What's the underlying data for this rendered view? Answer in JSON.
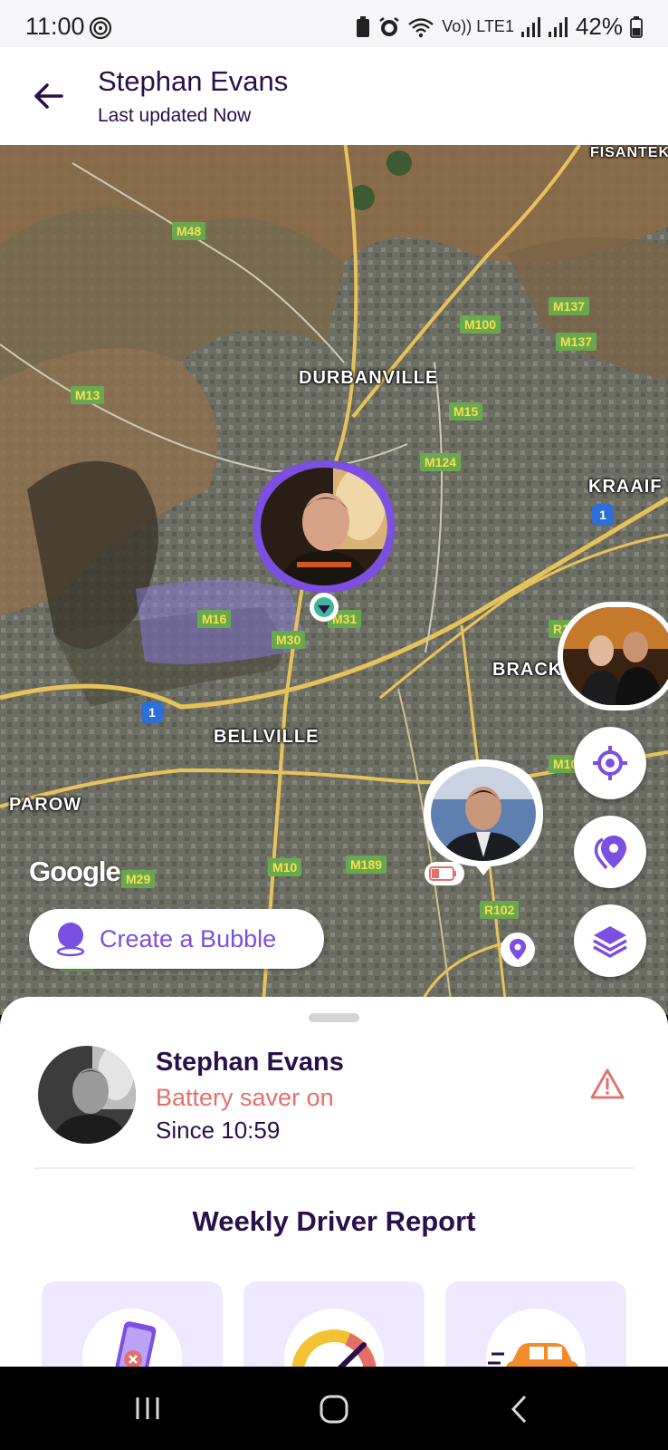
{
  "status_bar": {
    "time": "11:00",
    "network": "Vo)) LTE1",
    "battery": "42%",
    "icons": [
      "whatsapp-icon",
      "battery-saver-icon",
      "alarm-icon",
      "wifi-icon",
      "signal-icon",
      "signal-icon",
      "battery-icon"
    ]
  },
  "header": {
    "title": "Stephan Evans",
    "subtitle": "Last updated Now",
    "back_icon": "arrow-left-icon"
  },
  "map": {
    "places": [
      "DURBANVILLE",
      "BELLVILLE",
      "PAROW",
      "KRAAIF",
      "BRACK",
      "FISANTEK"
    ],
    "road_labels": [
      "M48",
      "M100",
      "M137",
      "M137",
      "M13",
      "M15",
      "M124",
      "M16",
      "M31",
      "M30",
      "R1",
      "M10",
      "M29",
      "M10",
      "M189",
      "R102",
      "M12",
      "1",
      "1",
      "1"
    ],
    "attribution": "Google",
    "create_bubble_label": "Create a Bubble",
    "fab_icons": [
      "locate-icon",
      "places-icon",
      "layers-icon"
    ]
  },
  "sheet": {
    "person_name": "Stephan Evans",
    "status": "Battery saver on",
    "since": "Since 10:59",
    "warning_icon": "warning-icon",
    "section_title": "Weekly Driver Report",
    "cards": [
      {
        "icon": "phone-usage-icon"
      },
      {
        "icon": "speedometer-icon"
      },
      {
        "icon": "car-icon"
      }
    ]
  },
  "colors": {
    "brand_purple": "#7b4fe0",
    "dark_purple": "#2a0f4a",
    "alert_red": "#e46f6a",
    "card_bg": "#efe9ff"
  },
  "nav_bar": {
    "icons": [
      "recent-apps-icon",
      "home-icon",
      "back-icon"
    ]
  }
}
